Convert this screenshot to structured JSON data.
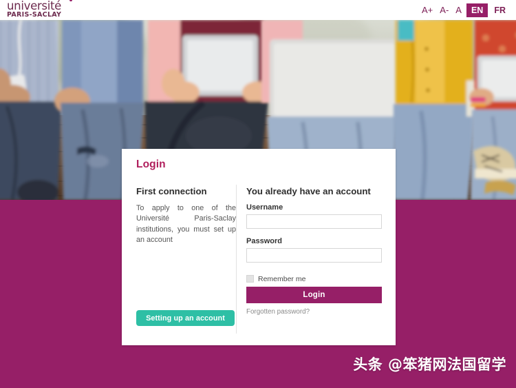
{
  "header": {
    "logo": {
      "line1": "université",
      "line2": "PARIS-SACLAY",
      "dot_icon": "accent-dot-icon"
    },
    "font_controls": [
      {
        "label": "A+",
        "name": "font-increase-button"
      },
      {
        "label": "A-",
        "name": "font-decrease-button"
      },
      {
        "label": "A",
        "name": "font-reset-button"
      }
    ],
    "languages": [
      {
        "label": "EN",
        "active": true
      },
      {
        "label": "FR",
        "active": false
      }
    ]
  },
  "hero": {
    "alt": "students-sitting-on-bench-with-tablets-and-laptop"
  },
  "card": {
    "title": "Login",
    "left": {
      "heading": "First connection",
      "paragraph": "To apply to one of the Université Paris-Saclay institutions, you must set up an account",
      "button_label": "Setting up an account"
    },
    "right": {
      "heading": "You already have an account",
      "username_label": "Username",
      "username_value": "",
      "username_placeholder": "",
      "password_label": "Password",
      "password_value": "",
      "password_placeholder": "",
      "remember_label": "Remember me",
      "remember_checked": false,
      "login_label": "Login",
      "forgot_label": "Forgotten password?"
    }
  },
  "watermark": {
    "text": "头条 @笨猪网法国留学"
  },
  "colors": {
    "brand_magenta": "#961F67",
    "title_magenta": "#b01e5c",
    "accent_teal": "#2ebfa5",
    "header_bg": "#ffffff",
    "card_bg": "#ffffff",
    "input_border": "#d6d6d6"
  }
}
